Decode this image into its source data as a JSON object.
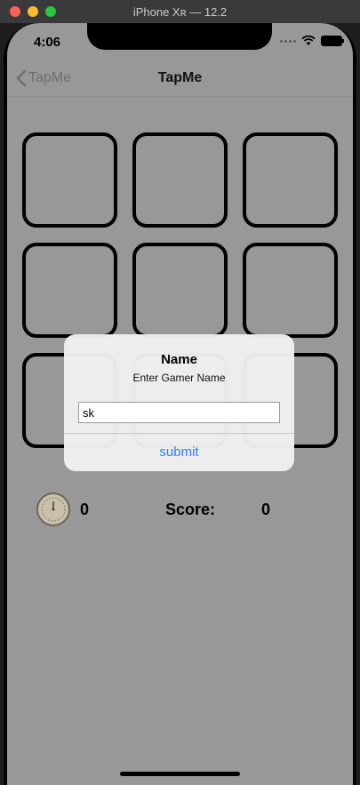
{
  "simulator": {
    "title": "iPhone Xʀ — 12.2"
  },
  "status_bar": {
    "time": "4:06"
  },
  "nav": {
    "back_label": "TapMe",
    "title": "TapMe"
  },
  "stats": {
    "timer_value": "0",
    "score_label": "Score:",
    "score_value": "0"
  },
  "alert": {
    "title": "Name",
    "message": "Enter Gamer Name",
    "input_value": "sk",
    "submit_label": "submit"
  },
  "colors": {
    "screen_bg": "#989898",
    "accent": "#2f7ff0"
  }
}
